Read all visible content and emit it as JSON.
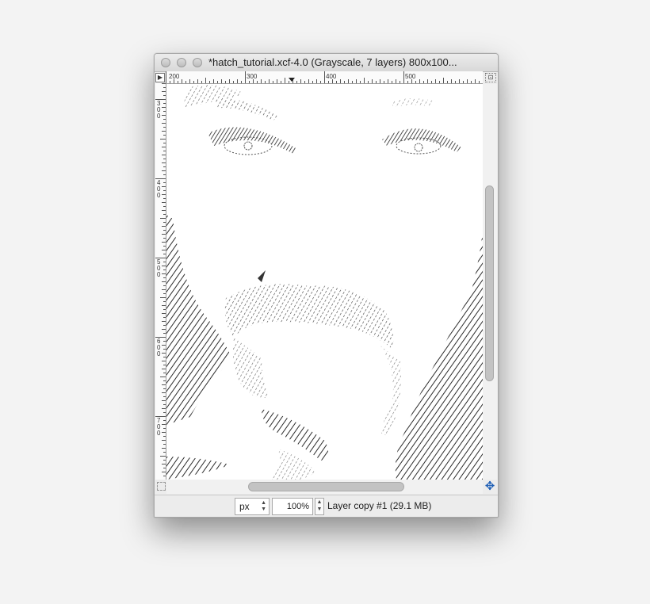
{
  "window": {
    "title": "*hatch_tutorial.xcf-4.0 (Grayscale, 7 layers) 800x100...",
    "nav_icon": "arrow-right-icon",
    "zoom_fit_icon": "zoom-fit-icon"
  },
  "rulers": {
    "horizontal_labels": [
      "200",
      "300",
      "400",
      "500"
    ],
    "vertical_labels": [
      "300",
      "400",
      "500",
      "600",
      "700"
    ]
  },
  "statusbar": {
    "unit": "px",
    "zoom": "100",
    "zoom_unit": "%",
    "layer_info": "Layer copy #1 (29.1 MB)"
  },
  "icons": {
    "navigate": "move-cross-icon",
    "quick_mask": "quick-mask-icon"
  },
  "colors": {
    "hatch": "#2b2b2b",
    "canvas": "#ffffff",
    "navigate_accent": "#1f5fb6"
  }
}
